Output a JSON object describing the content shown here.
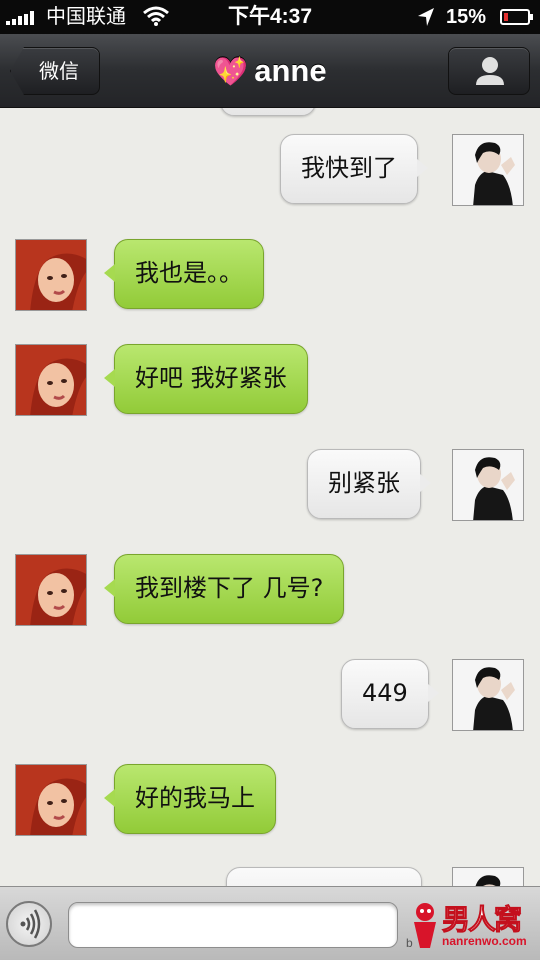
{
  "status_bar": {
    "carrier": "中国联通",
    "time": "下午4:37",
    "battery_percent": "15%",
    "battery_level": 0.15,
    "icons": [
      "signal-icon",
      "wifi-icon",
      "location-icon",
      "battery-icon"
    ]
  },
  "nav": {
    "back_label": "微信",
    "title": "anne",
    "title_icon": "heart-gift-icon",
    "profile_icon": "person-icon"
  },
  "messages": [
    {
      "side": "out",
      "text": "我快到了"
    },
    {
      "side": "in",
      "text": "我也是。。"
    },
    {
      "side": "in",
      "text": "好吧 我好紧张"
    },
    {
      "side": "out",
      "text": "别紧张"
    },
    {
      "side": "in",
      "text": "我到楼下了 几号?"
    },
    {
      "side": "out",
      "text": "449"
    },
    {
      "side": "in",
      "text": "好的我马上"
    },
    {
      "side": "out",
      "text": ""
    }
  ],
  "input_bar": {
    "voice_icon": "voice-wave-icon",
    "input_value": "",
    "input_placeholder": ""
  },
  "watermark": {
    "brand": "男人窝",
    "url": "nanrenwo.com",
    "prefix": "b"
  },
  "colors": {
    "incoming_bubble": "#a6da50",
    "outgoing_bubble": "#ececec",
    "nav_bar": "#2c2e31",
    "background": "#ecece8",
    "battery_low": "#e23030"
  }
}
